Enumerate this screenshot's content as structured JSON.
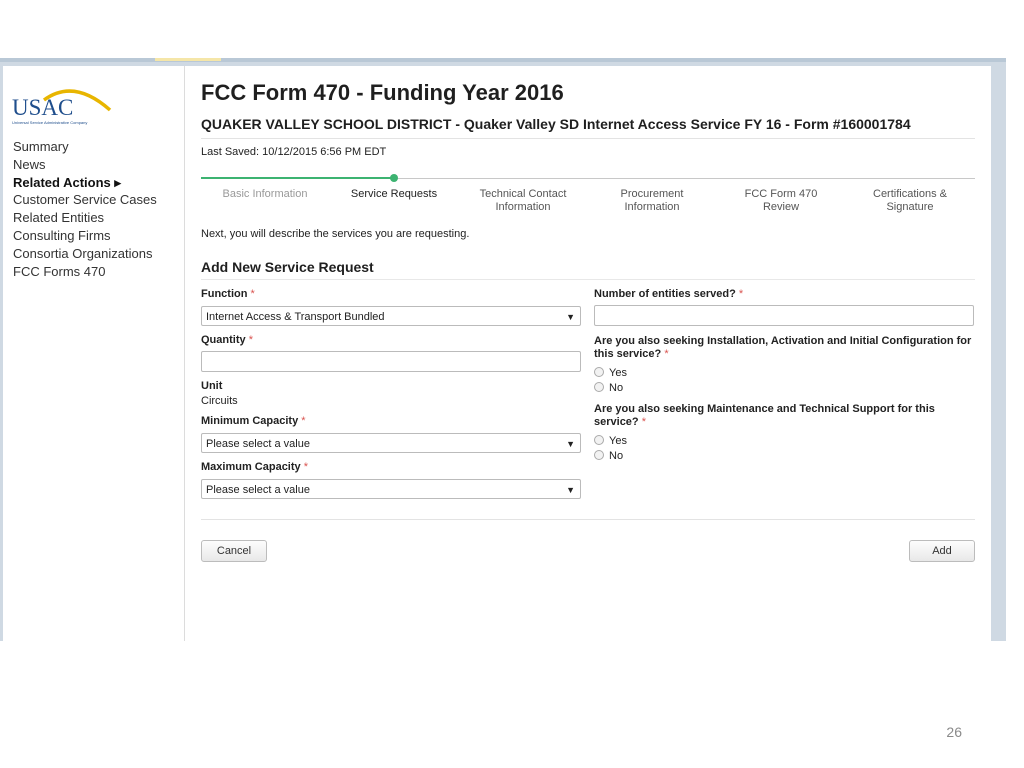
{
  "logo": {
    "text": "USAC",
    "tagline": "Universal Service Administrative Company"
  },
  "sidebar": {
    "items": [
      {
        "label": "Summary",
        "bold": false
      },
      {
        "label": "News",
        "bold": false
      },
      {
        "label": "Related Actions ▸",
        "bold": true
      },
      {
        "label": "Customer Service Cases",
        "bold": false
      },
      {
        "label": "Related Entities",
        "bold": false
      },
      {
        "label": "Consulting Firms",
        "bold": false
      },
      {
        "label": "Consortia Organizations",
        "bold": false
      },
      {
        "label": "FCC Forms 470",
        "bold": false
      }
    ]
  },
  "header": {
    "title": "FCC Form 470 - Funding Year 2016",
    "subtitle": "QUAKER VALLEY SCHOOL DISTRICT - Quaker Valley SD Internet Access Service FY 16 - Form #160001784",
    "last_saved": "Last Saved: 10/12/2015 6:56 PM EDT"
  },
  "steps": {
    "items": [
      {
        "label": "Basic Information",
        "state": "done"
      },
      {
        "label": "Service Requests",
        "state": "active"
      },
      {
        "label": "Technical Contact Information",
        "state": "upcoming"
      },
      {
        "label": "Procurement Information",
        "state": "upcoming"
      },
      {
        "label": "FCC Form 470 Review",
        "state": "upcoming"
      },
      {
        "label": "Certifications & Signature",
        "state": "upcoming"
      }
    ]
  },
  "intro": "Next, you will describe the services you are requesting.",
  "form": {
    "heading": "Add New Service Request",
    "required_mark": "*",
    "function_label": "Function",
    "function_value": "Internet Access & Transport Bundled",
    "quantity_label": "Quantity",
    "quantity_value": "",
    "unit_label": "Unit",
    "unit_value": "Circuits",
    "min_capacity_label": "Minimum Capacity",
    "min_capacity_value": "Please select a value",
    "max_capacity_label": "Maximum Capacity",
    "max_capacity_value": "Please select a value",
    "entities_label": "Number of entities served?",
    "entities_value": "",
    "installation_question": "Are you also seeking Installation, Activation and Initial Configuration for this service?",
    "maintenance_question": "Are you also seeking Maintenance and Technical Support for this service?",
    "yes_label": "Yes",
    "no_label": "No",
    "dropdown_arrow": "▼"
  },
  "buttons": {
    "cancel": "Cancel",
    "add": "Add"
  },
  "slide": {
    "page_number": "26"
  },
  "colors": {
    "accent_green": "#3cb371",
    "required_red": "#d9534f",
    "logo_blue": "#1f4e8c",
    "logo_gold": "#e8b500"
  }
}
